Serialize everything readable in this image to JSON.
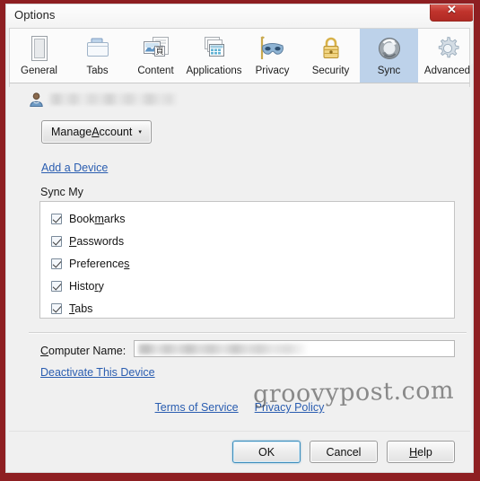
{
  "window": {
    "title": "Options",
    "close_label": "✕",
    "chrome_color": "#8e1f22",
    "background": "#f0f0f0"
  },
  "tabs": [
    {
      "id": "general",
      "label": "General",
      "icon": "general-page-icon",
      "selected": false
    },
    {
      "id": "tabs",
      "label": "Tabs",
      "icon": "folder-tabs-icon",
      "selected": false
    },
    {
      "id": "content",
      "label": "Content",
      "icon": "content-page-icon",
      "selected": false
    },
    {
      "id": "applications",
      "label": "Applications",
      "icon": "applications-icon",
      "selected": false
    },
    {
      "id": "privacy",
      "label": "Privacy",
      "icon": "privacy-mask-icon",
      "selected": false
    },
    {
      "id": "security",
      "label": "Security",
      "icon": "security-lock-icon",
      "selected": false
    },
    {
      "id": "sync",
      "label": "Sync",
      "icon": "sync-arrows-icon",
      "selected": true
    },
    {
      "id": "advanced",
      "label": "Advanced",
      "icon": "advanced-gear-icon",
      "selected": false
    }
  ],
  "selection_color": "#bdd2ea",
  "account": {
    "avatar_icon": "user-avatar-icon",
    "username": "",
    "username_redacted": true,
    "manage_button": {
      "before": "Manage ",
      "accel": "A",
      "after": "ccount",
      "caret": "▾"
    },
    "add_device_link": "Add a Device"
  },
  "sync_my": {
    "group_label": "Sync My",
    "items": [
      {
        "label_before": "Book",
        "accel": "m",
        "label_after": "arks",
        "checked": true,
        "name": "bookmarks"
      },
      {
        "label_before": "",
        "accel": "P",
        "label_after": "asswords",
        "checked": true,
        "name": "passwords"
      },
      {
        "label_before": "Preference",
        "accel": "s",
        "label_after": "",
        "checked": true,
        "name": "preferences"
      },
      {
        "label_before": "Histo",
        "accel": "r",
        "label_after": "y",
        "checked": true,
        "name": "history"
      },
      {
        "label_before": "",
        "accel": "T",
        "label_after": "abs",
        "checked": true,
        "name": "tabs"
      }
    ]
  },
  "device": {
    "computer_name_label_before": "",
    "computer_name_accel": "C",
    "computer_name_label_after": "omputer Name:",
    "computer_name_value": "",
    "computer_name_redacted": true,
    "deactivate_link": "Deactivate This Device"
  },
  "legal": {
    "terms_link": "Terms of Service",
    "privacy_link": "Privacy Policy"
  },
  "watermark": "groovypost.com",
  "buttons": {
    "ok": "OK",
    "cancel": "Cancel",
    "help_before": "",
    "help_accel": "H",
    "help_after": "elp"
  }
}
